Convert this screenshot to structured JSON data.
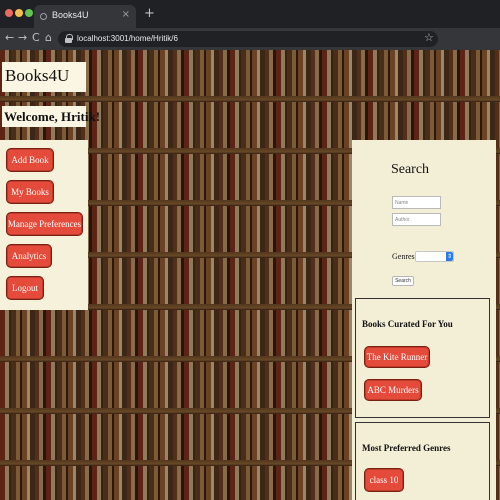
{
  "browser": {
    "tab_title": "Books4U",
    "tab_close": "×",
    "new_tab": "+",
    "url": "localhost:3001/home/Hritik/6",
    "nav": {
      "back": "←",
      "forward": "→",
      "reload": "C",
      "home": "⌂"
    },
    "bookmark": "☆"
  },
  "app": {
    "brand": "Books4U",
    "welcome": "Welcome, Hritik!"
  },
  "menu": {
    "items": [
      "Add Book",
      "My Books",
      "Manage Preferences",
      "Analytics",
      "Logout"
    ]
  },
  "search": {
    "title": "Search",
    "name_placeholder": "Name",
    "author_placeholder": "Author",
    "genres_label": "Genres",
    "genre_selected": "",
    "button_label": "Search"
  },
  "curated": {
    "title": "Books Curated For You",
    "books": [
      "The Kite Runner",
      "ABC Murders"
    ]
  },
  "preferred": {
    "title": "Most Preferred Genres",
    "genres": [
      "class 10"
    ]
  },
  "colors": {
    "button_red": "#e54b3a",
    "panel_cream": "#f3efd6",
    "chrome_dark": "#202124"
  }
}
